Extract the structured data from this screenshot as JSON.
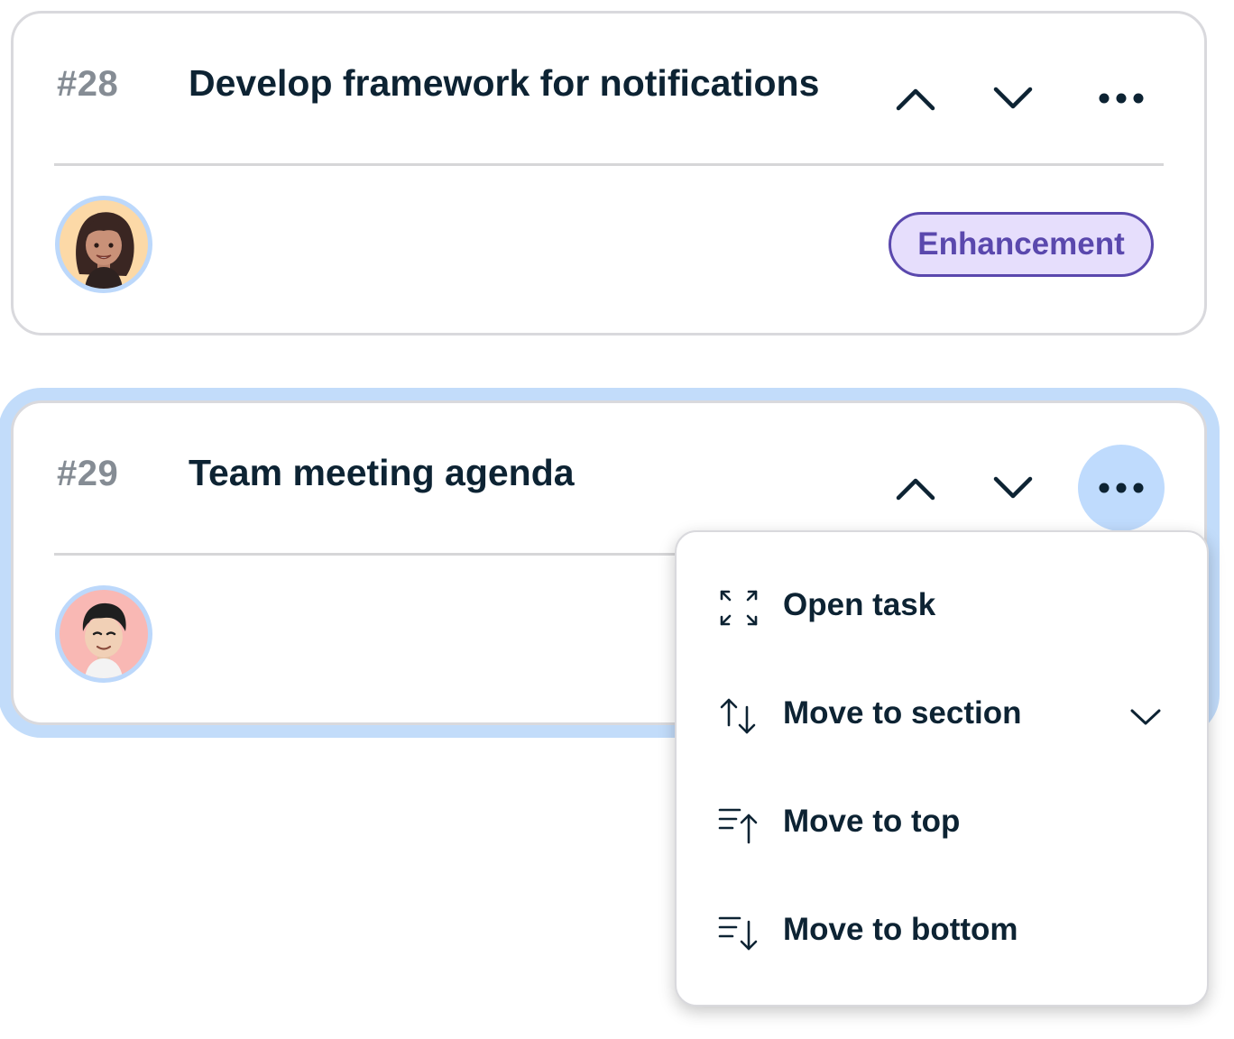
{
  "tasks": [
    {
      "number": "#28",
      "title": "Develop framework for notifications",
      "tag": "Enhancement",
      "avatar": "woman-memoji-avatar"
    },
    {
      "number": "#29",
      "title": "Team meeting agenda",
      "avatar": "man-memoji-avatar"
    }
  ],
  "menu": {
    "items": [
      {
        "label": "Open task",
        "icon": "expand-icon"
      },
      {
        "label": "Move to section",
        "icon": "swap-vertical-icon",
        "has_submenu": true
      },
      {
        "label": "Move to top",
        "icon": "sort-to-top-icon"
      },
      {
        "label": "Move to bottom",
        "icon": "sort-to-bottom-icon"
      }
    ]
  },
  "colors": {
    "text": "#0d2333",
    "muted": "#858c94",
    "selection": "#c2dcfa",
    "tag_border": "#5a48ad",
    "tag_fill": "#e6defc",
    "active_button": "#bfdbfd"
  }
}
